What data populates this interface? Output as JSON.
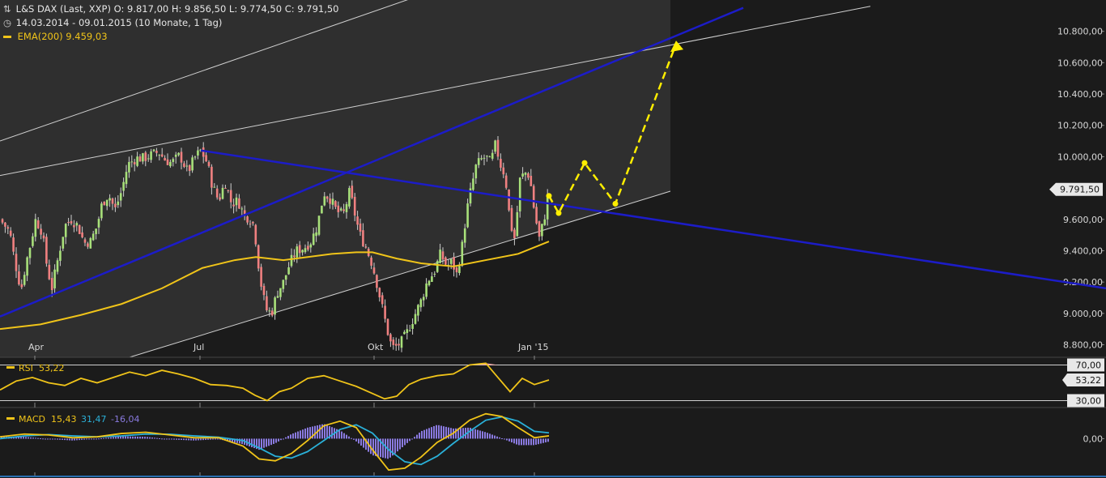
{
  "header": {
    "line1": "L&S DAX (Last, XXP)  O: 9.817,00  H: 9.856,50  L: 9.774,50  C: 9.791,50",
    "line2": "14.03.2014 - 09.01.2015 (10 Monate, 1 Tag)",
    "ema_label": "EMA(200)",
    "ema_value": "9.459,03"
  },
  "colors": {
    "background": "#1b1b1b",
    "channel_fill": "#2f2f2f",
    "up_candle": "#a8e07a",
    "down_candle": "#f08080",
    "ema": "#f0c419",
    "trendline": "#1c1cc8",
    "forecast": "#ffee00",
    "rsi": "#f0c419",
    "macd": "#f0c419",
    "signal": "#2ab0d8",
    "histogram": "#8a7ae0"
  },
  "chart_data": [
    {
      "type": "candlestick",
      "name": "L&S DAX",
      "x_tick_labels": [
        "Apr",
        "Jul",
        "Okt",
        "Jan '15"
      ],
      "y_tick_labels": [
        "10.800,00",
        "10.600,00",
        "10.400,00",
        "10.200,00",
        "10.000,00",
        "9.600,00",
        "9.400,00",
        "9.200,00",
        "9.000,00",
        "8.800,00"
      ],
      "y_ticks": [
        10800,
        10600,
        10400,
        10200,
        10000,
        9600,
        9400,
        9200,
        9000,
        8800
      ],
      "ylim": [
        8720,
        11000
      ],
      "last_price_label": "9.791,50",
      "last_price": 9791.5,
      "close_path": [
        [
          0,
          9600
        ],
        [
          6,
          9560
        ],
        [
          12,
          9520
        ],
        [
          18,
          9340
        ],
        [
          26,
          9150
        ],
        [
          32,
          9320
        ],
        [
          38,
          9450
        ],
        [
          44,
          9600
        ],
        [
          52,
          9520
        ],
        [
          58,
          9300
        ],
        [
          64,
          9160
        ],
        [
          72,
          9360
        ],
        [
          80,
          9560
        ],
        [
          88,
          9600
        ],
        [
          96,
          9560
        ],
        [
          104,
          9450
        ],
        [
          112,
          9460
        ],
        [
          120,
          9560
        ],
        [
          126,
          9700
        ],
        [
          134,
          9760
        ],
        [
          142,
          9660
        ],
        [
          150,
          9780
        ],
        [
          158,
          9950
        ],
        [
          168,
          9990
        ],
        [
          178,
          9990
        ],
        [
          186,
          10010
        ],
        [
          196,
          10030
        ],
        [
          204,
          9980
        ],
        [
          212,
          9960
        ],
        [
          222,
          10010
        ],
        [
          232,
          9900
        ],
        [
          240,
          9990
        ],
        [
          248,
          10040
        ],
        [
          256,
          9960
        ],
        [
          262,
          9820
        ],
        [
          270,
          9720
        ],
        [
          278,
          9840
        ],
        [
          286,
          9700
        ],
        [
          294,
          9720
        ],
        [
          302,
          9620
        ],
        [
          308,
          9610
        ],
        [
          314,
          9560
        ],
        [
          318,
          9360
        ],
        [
          324,
          9130
        ],
        [
          330,
          9010
        ],
        [
          336,
          9010
        ],
        [
          342,
          9130
        ],
        [
          350,
          9200
        ],
        [
          358,
          9320
        ],
        [
          366,
          9400
        ],
        [
          376,
          9420
        ],
        [
          384,
          9460
        ],
        [
          392,
          9560
        ],
        [
          400,
          9770
        ],
        [
          408,
          9730
        ],
        [
          416,
          9650
        ],
        [
          424,
          9630
        ],
        [
          432,
          9780
        ],
        [
          438,
          9640
        ],
        [
          444,
          9510
        ],
        [
          452,
          9420
        ],
        [
          460,
          9310
        ],
        [
          466,
          9180
        ],
        [
          472,
          9040
        ],
        [
          478,
          8900
        ],
        [
          484,
          8780
        ],
        [
          490,
          8790
        ],
        [
          496,
          8820
        ],
        [
          502,
          8870
        ],
        [
          508,
          8940
        ],
        [
          514,
          9010
        ],
        [
          520,
          9080
        ],
        [
          528,
          9210
        ],
        [
          536,
          9260
        ],
        [
          544,
          9380
        ],
        [
          552,
          9300
        ],
        [
          558,
          9330
        ],
        [
          564,
          9250
        ],
        [
          570,
          9400
        ],
        [
          576,
          9640
        ],
        [
          582,
          9800
        ],
        [
          588,
          9940
        ],
        [
          594,
          9980
        ],
        [
          600,
          10000
        ],
        [
          606,
          9960
        ],
        [
          612,
          10080
        ],
        [
          618,
          9950
        ],
        [
          624,
          9880
        ],
        [
          630,
          9580
        ],
        [
          636,
          9470
        ],
        [
          642,
          9850
        ],
        [
          648,
          9900
        ],
        [
          654,
          9880
        ],
        [
          660,
          9650
        ],
        [
          666,
          9480
        ],
        [
          672,
          9600
        ],
        [
          678,
          9791.5
        ]
      ],
      "ema200_path": [
        [
          0,
          8900
        ],
        [
          50,
          8930
        ],
        [
          100,
          8990
        ],
        [
          150,
          9060
        ],
        [
          200,
          9160
        ],
        [
          250,
          9290
        ],
        [
          290,
          9340
        ],
        [
          316,
          9360
        ],
        [
          350,
          9340
        ],
        [
          380,
          9360
        ],
        [
          410,
          9380
        ],
        [
          440,
          9390
        ],
        [
          460,
          9390
        ],
        [
          490,
          9350
        ],
        [
          520,
          9320
        ],
        [
          560,
          9300
        ],
        [
          600,
          9340
        ],
        [
          640,
          9380
        ],
        [
          678,
          9459.03
        ]
      ],
      "forecast_path": [
        [
          678,
          9750
        ],
        [
          690,
          9640
        ],
        [
          722,
          9960
        ],
        [
          760,
          9700
        ],
        [
          835,
          10720
        ]
      ],
      "blue_trendlines": [
        {
          "from": [
            0,
            8980
          ],
          "to": [
            918,
            10950
          ]
        },
        {
          "from": [
            248,
            10040
          ],
          "to": [
            1366,
            9160
          ]
        }
      ],
      "channel": {
        "upper": {
          "from": [
            0,
            10100
          ],
          "to": [
            508,
            11010
          ]
        },
        "middle": {
          "from": [
            0,
            9880
          ],
          "to": [
            1075,
            10960
          ]
        },
        "lower": {
          "from": [
            160,
            8720
          ],
          "to": [
            828,
            9780
          ]
        }
      },
      "shaded_range": [
        0,
        828
      ]
    },
    {
      "type": "line",
      "name": "RSI",
      "label": "RSI",
      "value_label": "53,22",
      "value": 53.22,
      "levels": [
        70,
        30
      ],
      "level_labels": [
        "70,00",
        "30,00"
      ],
      "value_box": "53,22",
      "ylim": [
        25,
        75
      ],
      "x": [
        0,
        20,
        40,
        60,
        80,
        100,
        120,
        140,
        160,
        180,
        200,
        220,
        240,
        260,
        280,
        300,
        315,
        330,
        345,
        360,
        380,
        400,
        420,
        440,
        460,
        475,
        490,
        505,
        520,
        540,
        560,
        580,
        600,
        615,
        630,
        645,
        660,
        678
      ],
      "values": [
        42,
        52,
        56,
        50,
        47,
        55,
        50,
        56,
        62,
        58,
        64,
        60,
        55,
        48,
        47,
        44,
        36,
        30,
        40,
        44,
        55,
        58,
        52,
        46,
        38,
        32,
        35,
        48,
        54,
        58,
        60,
        70,
        72,
        56,
        40,
        55,
        48,
        53.22
      ]
    },
    {
      "type": "line",
      "name": "MACD",
      "label": "MACD",
      "macd_value": "15,43",
      "signal_value": "31,47",
      "hist_value": "-16,04",
      "zero_label": "0,00",
      "ylim": [
        -200,
        160
      ],
      "x": [
        0,
        30,
        60,
        90,
        120,
        150,
        180,
        210,
        240,
        270,
        300,
        320,
        340,
        360,
        380,
        400,
        420,
        440,
        460,
        480,
        500,
        520,
        540,
        560,
        580,
        600,
        620,
        640,
        660,
        678
      ],
      "macd": [
        10,
        25,
        20,
        5,
        10,
        28,
        35,
        20,
        5,
        5,
        -40,
        -110,
        -120,
        -80,
        -10,
        70,
        95,
        60,
        -60,
        -170,
        -160,
        -100,
        -20,
        30,
        100,
        135,
        120,
        60,
        5,
        15.43
      ],
      "signal": [
        0,
        15,
        22,
        15,
        10,
        15,
        25,
        24,
        15,
        8,
        -10,
        -50,
        -95,
        -105,
        -70,
        -10,
        50,
        75,
        30,
        -60,
        -125,
        -140,
        -95,
        -25,
        40,
        100,
        118,
        95,
        40,
        31.47
      ],
      "histogram": [
        10,
        10,
        -2,
        -10,
        0,
        13,
        10,
        -4,
        -10,
        -3,
        -30,
        -60,
        -25,
        25,
        60,
        80,
        45,
        -15,
        -90,
        -110,
        -35,
        40,
        75,
        55,
        60,
        35,
        2,
        -35,
        -35,
        -16.04
      ]
    }
  ]
}
